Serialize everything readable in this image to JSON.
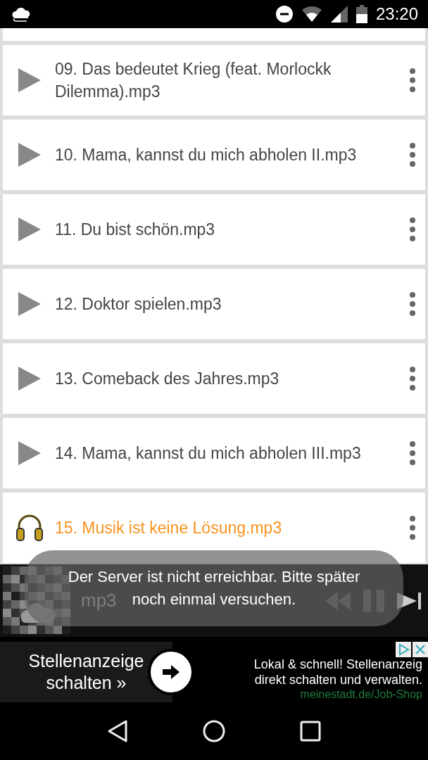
{
  "status_bar": {
    "time": "23:20"
  },
  "tracks": [
    {
      "title": "09. Das bedeutet Krieg (feat. Morlockk Dilemma).mp3",
      "selected": false
    },
    {
      "title": "10. Mama, kannst du mich abholen II.mp3",
      "selected": false
    },
    {
      "title": "11. Du bist schön.mp3",
      "selected": false
    },
    {
      "title": "12. Doktor spielen.mp3",
      "selected": false
    },
    {
      "title": "13. Comeback des Jahres.mp3",
      "selected": false
    },
    {
      "title": "14. Mama, kannst du mich abholen III.mp3",
      "selected": false
    },
    {
      "title": "15. Musik ist keine Lösung.mp3",
      "selected": true
    }
  ],
  "player": {
    "title": "mp3"
  },
  "toast": {
    "message": "Der Server ist nicht erreichbar. Bitte später noch einmal versuchen."
  },
  "ad": {
    "left_text": "Stellenanzeige",
    "left_text_2": "schalten »",
    "headline": "Lokal & schnell! Stellenanzeig",
    "body": "direkt schalten und verwalten.",
    "link": "meinestadt.de/Job-Shop"
  }
}
